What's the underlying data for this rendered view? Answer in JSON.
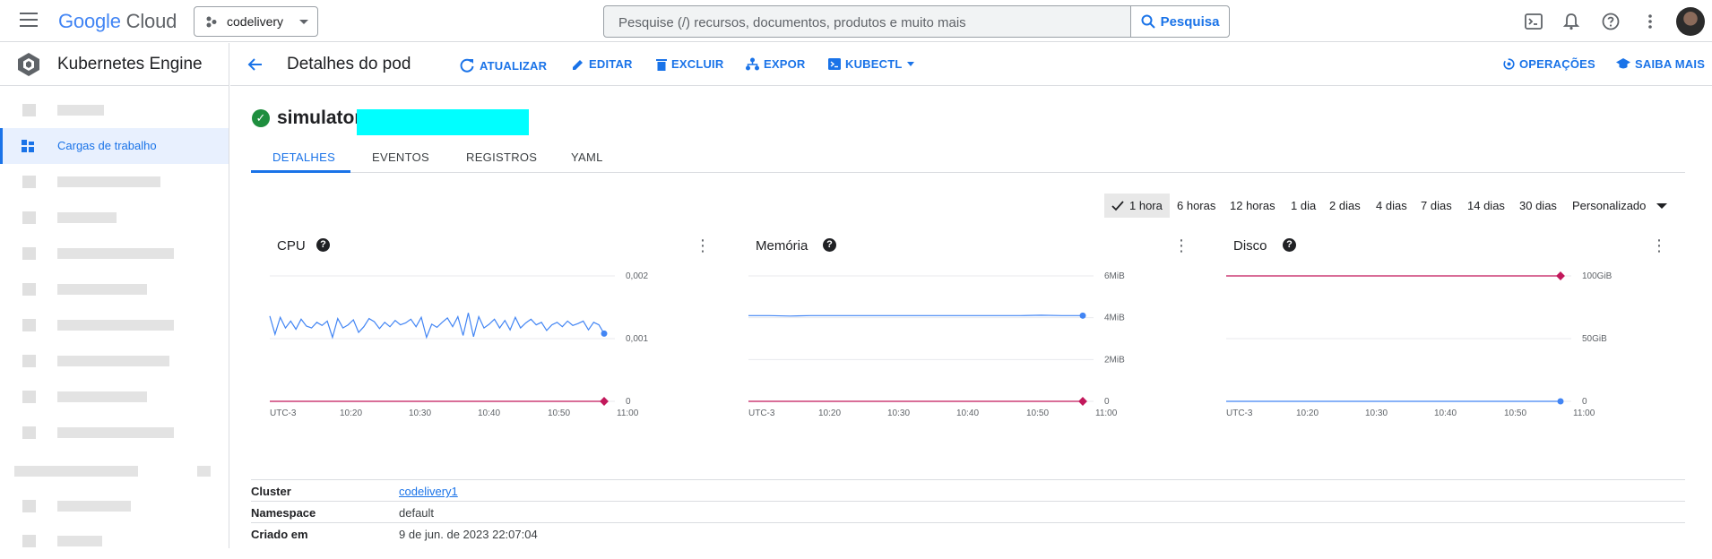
{
  "topbar": {
    "logo_google": "Google",
    "logo_cloud": "Cloud",
    "project": "codelivery",
    "search_placeholder": "Pesquise (/) recursos, documentos, produtos e muito mais",
    "search_button": "Pesquisa"
  },
  "sidebar": {
    "product": "Kubernetes Engine",
    "active_item": "Cargas de trabalho"
  },
  "actionbar": {
    "title": "Detalhes do pod",
    "actions": [
      "ATUALIZAR",
      "EDITAR",
      "EXCLUIR",
      "EXPOR",
      "KUBECTL"
    ],
    "right_actions": [
      "OPERAÇÕES",
      "SAIBA MAIS"
    ]
  },
  "pod": {
    "name": "simulator-"
  },
  "tabs": [
    "DETALHES",
    "EVENTOS",
    "REGISTROS",
    "YAML"
  ],
  "time_ranges": [
    "1 hora",
    "6 horas",
    "12 horas",
    "1 dia",
    "2 dias",
    "4 dias",
    "7 dias",
    "14 dias",
    "30 dias",
    "Personalizado"
  ],
  "selected_range": "1 hora",
  "chart_data": [
    {
      "type": "line",
      "title": "CPU",
      "x_ticks": [
        "UTC-3",
        "10:20",
        "10:30",
        "10:40",
        "10:50",
        "11:00"
      ],
      "y_ticks": [
        "0,002",
        "0,001",
        "0"
      ],
      "ylim": [
        0,
        0.002
      ],
      "series": [
        {
          "color": "#4285f4",
          "values": [
            0.00136,
            0.00107,
            0.00134,
            0.00117,
            0.00128,
            0.00115,
            0.00131,
            0.0012,
            0.00117,
            0.00126,
            0.00121,
            0.00128,
            0.00102,
            0.00132,
            0.00117,
            0.00122,
            0.0013,
            0.0011,
            0.00119,
            0.00132,
            0.00127,
            0.00116,
            0.00126,
            0.00119,
            0.00129,
            0.00122,
            0.00125,
            0.00131,
            0.00119,
            0.00134,
            0.00102,
            0.00123,
            0.00118,
            0.00126,
            0.00133,
            0.00119,
            0.00135,
            0.00105,
            0.00141,
            0.00103,
            0.00135,
            0.00117,
            0.00123,
            0.00131,
            0.00117,
            0.00129,
            0.00114,
            0.00134,
            0.00117,
            0.00125,
            0.00131,
            0.00122,
            0.00126,
            0.00113,
            0.00122,
            0.00126,
            0.00119,
            0.00128,
            0.00121,
            0.00124,
            0.00128,
            0.00114,
            0.00126,
            0.00122,
            0.00108
          ]
        },
        {
          "color": "#c2185b",
          "values": [
            0,
            0
          ]
        }
      ]
    },
    {
      "type": "line",
      "title": "Memória",
      "x_ticks": [
        "UTC-3",
        "10:20",
        "10:30",
        "10:40",
        "10:50",
        "11:00"
      ],
      "y_ticks": [
        "6MiB",
        "4MiB",
        "2MiB",
        "0"
      ],
      "ylim": [
        0,
        6
      ],
      "series": [
        {
          "color": "#4285f4",
          "values": [
            4.1,
            4.1,
            4.08,
            4.1,
            4.1,
            4.1,
            4.1,
            4.1,
            4.1,
            4.1,
            4.1,
            4.1,
            4.1,
            4.1,
            4.12,
            4.1,
            4.1
          ]
        },
        {
          "color": "#c2185b",
          "values": [
            0,
            0
          ]
        }
      ]
    },
    {
      "type": "line",
      "title": "Disco",
      "x_ticks": [
        "UTC-3",
        "10:20",
        "10:30",
        "10:40",
        "10:50",
        "11:00"
      ],
      "y_ticks": [
        "100GiB",
        "50GiB",
        "0"
      ],
      "ylim": [
        0,
        100
      ],
      "series": [
        {
          "color": "#c2185b",
          "values": [
            100,
            100
          ]
        },
        {
          "color": "#4285f4",
          "values": [
            0,
            0
          ]
        }
      ]
    }
  ],
  "details": [
    {
      "key": "Cluster",
      "value": "codelivery1"
    },
    {
      "key": "Namespace",
      "value": "default"
    },
    {
      "key": "Criado em",
      "value": "9 de jun. de 2023 22:07:04"
    }
  ]
}
